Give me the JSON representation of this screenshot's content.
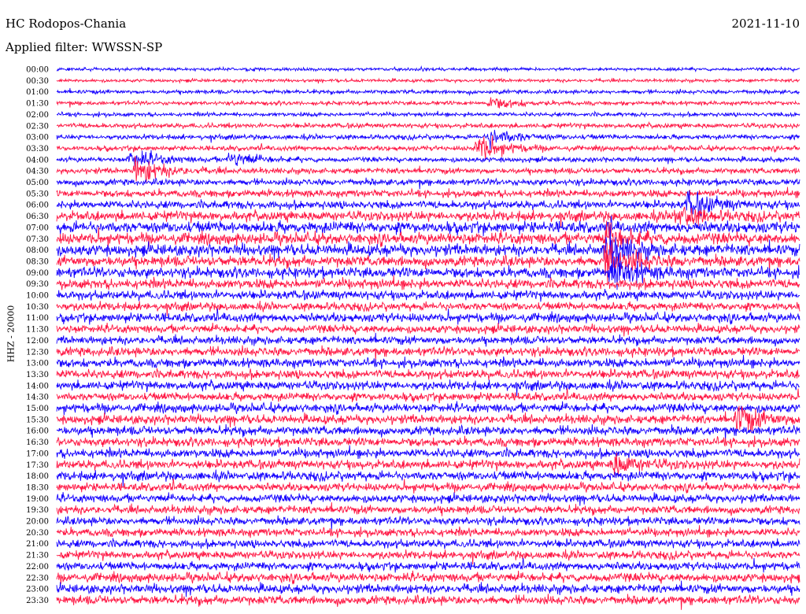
{
  "header": {
    "station": "HC Rodopos-Chania",
    "date": "2021-11-10",
    "filter": "Applied filter: WWSSN-SP"
  },
  "colors": {
    "background": "#ffffff",
    "trace_red": "#ff1744",
    "trace_blue": "#1400ff"
  },
  "chart_data": {
    "type": "line",
    "title": "HC Rodopos-Chania",
    "ylabel": "HHZ - 20000",
    "filter": "WWSSN-SP",
    "date": "2021-11-10",
    "trace_minutes": 30,
    "row_labels": [
      "00:00",
      "00:30",
      "01:00",
      "01:30",
      "02:00",
      "02:30",
      "03:00",
      "03:30",
      "04:00",
      "04:30",
      "05:00",
      "05:30",
      "06:00",
      "06:30",
      "07:00",
      "07:30",
      "08:00",
      "08:30",
      "09:00",
      "09:30",
      "10:00",
      "10:30",
      "11:00",
      "11:30",
      "12:00",
      "12:30",
      "13:00",
      "13:30",
      "14:00",
      "14:30",
      "15:00",
      "15:30",
      "16:00",
      "16:30",
      "17:00",
      "17:30",
      "18:00",
      "18:30",
      "19:00",
      "19:30",
      "20:00",
      "20:30",
      "21:00",
      "21:30",
      "22:00",
      "22:30",
      "23:00",
      "23:30"
    ],
    "row_colors": [
      "blue",
      "red",
      "blue",
      "red",
      "blue",
      "red",
      "blue",
      "red",
      "blue",
      "red",
      "blue",
      "red",
      "blue",
      "red",
      "blue",
      "red",
      "blue",
      "red",
      "blue",
      "red",
      "blue",
      "red",
      "blue",
      "red",
      "blue",
      "red",
      "blue",
      "red",
      "blue",
      "red",
      "blue",
      "red",
      "blue",
      "red",
      "blue",
      "red",
      "blue",
      "red",
      "blue",
      "red",
      "blue",
      "red",
      "blue",
      "red",
      "blue",
      "red",
      "blue",
      "red"
    ],
    "noise_amplitude": [
      0.2,
      0.2,
      0.25,
      0.25,
      0.25,
      0.3,
      0.3,
      0.3,
      0.3,
      0.35,
      0.4,
      0.45,
      0.5,
      0.6,
      0.7,
      0.7,
      0.7,
      0.65,
      0.65,
      0.6,
      0.55,
      0.5,
      0.55,
      0.5,
      0.5,
      0.55,
      0.55,
      0.55,
      0.55,
      0.5,
      0.55,
      0.55,
      0.55,
      0.55,
      0.55,
      0.55,
      0.55,
      0.5,
      0.5,
      0.5,
      0.5,
      0.5,
      0.5,
      0.5,
      0.5,
      0.55,
      0.55,
      0.55
    ],
    "events": [
      {
        "row": 3,
        "minute": 17.5,
        "amplitude": 0.8
      },
      {
        "row": 6,
        "minute": 17.5,
        "amplitude": 1.2
      },
      {
        "row": 7,
        "minute": 17.0,
        "amplitude": 1.8
      },
      {
        "row": 8,
        "minute": 7.0,
        "amplitude": 1.0
      },
      {
        "row": 8,
        "minute": 3.0,
        "amplitude": 1.4
      },
      {
        "row": 9,
        "minute": 3.2,
        "amplitude": 1.8
      },
      {
        "row": 12,
        "minute": 25.5,
        "amplitude": 1.6
      },
      {
        "row": 13,
        "minute": 25.0,
        "amplitude": 1.4
      },
      {
        "row": 15,
        "minute": 22.2,
        "amplitude": 1.4
      },
      {
        "row": 16,
        "minute": 22.2,
        "amplitude": 2.0
      },
      {
        "row": 17,
        "minute": 22.2,
        "amplitude": 2.4
      },
      {
        "row": 18,
        "minute": 22.4,
        "amplitude": 2.2
      },
      {
        "row": 31,
        "minute": 27.5,
        "amplitude": 1.8
      },
      {
        "row": 35,
        "minute": 22.5,
        "amplitude": 1.3
      }
    ]
  }
}
